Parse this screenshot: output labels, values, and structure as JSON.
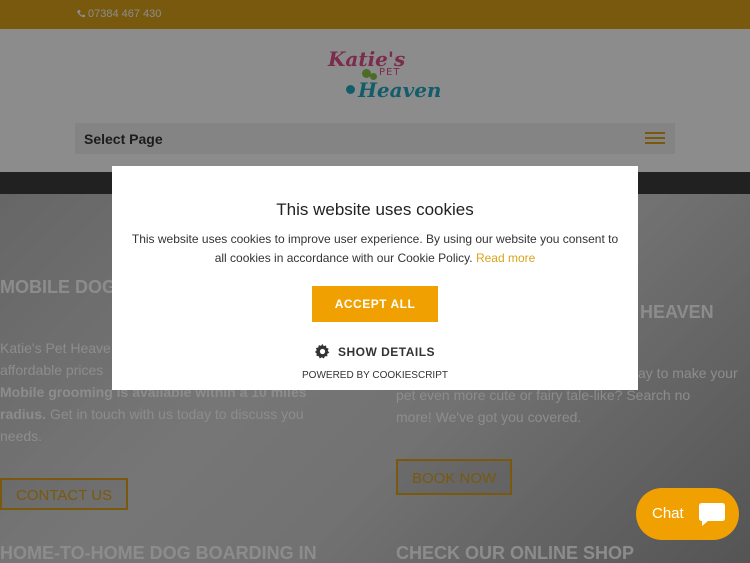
{
  "topbar": {
    "phone": "07384 467 430"
  },
  "logo": {
    "line1": "Katie's",
    "line2": "PET",
    "line3": "Heaven"
  },
  "nav": {
    "select_label": "Select Page"
  },
  "hero": {
    "left_heading": "MOBILE DOG",
    "left_text_1": "Katie's Pet Heave",
    "left_text_2": "affordable prices",
    "left_text_bold": "Mobile grooming is available within a 10 miles radius.",
    "left_text_tail": "Get in touch with us today to discuss you",
    "left_text_end": "needs.",
    "left_button": "CONTACT US",
    "right_heading_1": "E",
    "right_heading_2": "HEAVEN",
    "right_text_1": "ay to make your",
    "right_text_2": "pet even more cute or fairy tale-like? Search no",
    "right_text_3": "more! We've got you covered.",
    "right_button": "BOOK NOW",
    "bottom_left_heading": "HOME-TO-HOME DOG BOARDING IN",
    "bottom_right_heading": "CHECK OUR ONLINE SHOP"
  },
  "cookie_modal": {
    "title": "This website uses cookies",
    "body": "This website uses cookies to improve user experience. By using our website you consent to all cookies in accordance with our Cookie Policy.",
    "read_more": "Read more",
    "accept_button": "ACCEPT ALL",
    "show_details": "SHOW DETAILS",
    "powered_by": "POWERED BY COOKIESCRIPT"
  },
  "chat": {
    "label": "Chat"
  },
  "colors": {
    "brand": "#dba31b",
    "accept": "#f0a000",
    "logo_pink": "#e0508c",
    "logo_teal": "#23a9c4"
  }
}
